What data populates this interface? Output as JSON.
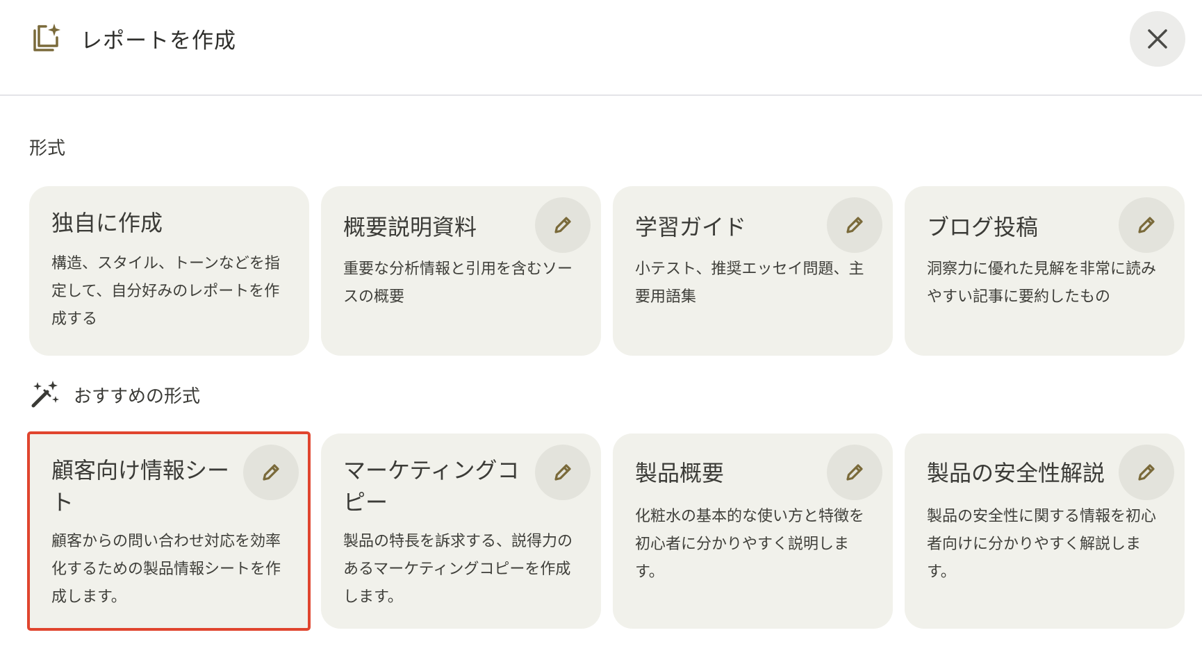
{
  "header": {
    "title": "レポートを作成",
    "icon": "report-sparkle-icon",
    "close_icon": "close-icon"
  },
  "formats": {
    "label": "形式",
    "cards": [
      {
        "title": "独自に作成",
        "description": "構造、スタイル、トーンなどを指定して、自分好みのレポートを作成する"
      },
      {
        "title": "概要説明資料",
        "description": "重要な分析情報と引用を含むソースの概要",
        "edit_icon": "pencil-icon"
      },
      {
        "title": "学習ガイド",
        "description": "小テスト、推奨エッセイ問題、主要用語集",
        "edit_icon": "pencil-icon"
      },
      {
        "title": "ブログ投稿",
        "description": "洞察力に優れた見解を非常に読みやすい記事に要約したもの",
        "edit_icon": "pencil-icon"
      }
    ]
  },
  "recommended": {
    "label": "おすすめの形式",
    "icon": "magic-wand-icon",
    "cards": [
      {
        "title": "顧客向け情報シート",
        "description": "顧客からの問い合わせ対応を効率化するための製品情報シートを作成します。",
        "edit_icon": "pencil-icon",
        "selected": true
      },
      {
        "title": "マーケティングコピー",
        "description": "製品の特長を訴求する、説得力のあるマーケティングコピーを作成します。",
        "edit_icon": "pencil-icon"
      },
      {
        "title": "製品概要",
        "description": "化粧水の基本的な使い方と特徴を初心者に分かりやすく説明します。",
        "edit_icon": "pencil-icon"
      },
      {
        "title": "製品の安全性解説",
        "description": "製品の安全性に関する情報を初心者向けに分かりやすく解説します。",
        "edit_icon": "pencil-icon"
      }
    ]
  },
  "colors": {
    "accent_icon": "#7a6a3a",
    "card_bg": "#f1f1eb",
    "selection_outline": "#e0452e"
  }
}
